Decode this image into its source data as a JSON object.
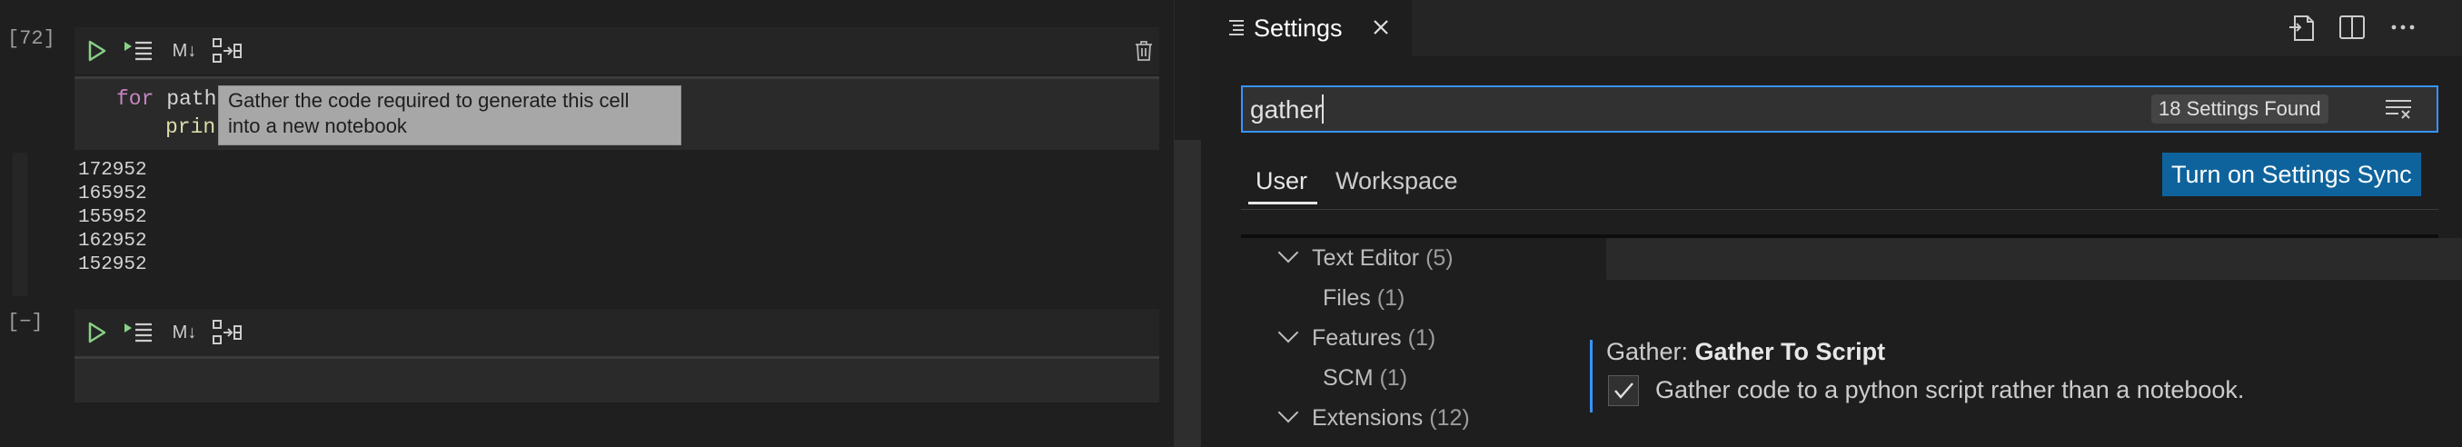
{
  "notebook": {
    "cell1": {
      "exec_count": "[72]",
      "toolbar": {
        "run_label": "run-cell",
        "markdown_label": "M↓",
        "gather_label": "gather-cell"
      },
      "code": {
        "line1_kw": "for",
        "line1_rest": " path",
        "line2_fn": "prin"
      },
      "tooltip": {
        "line1": "Gather the code required to generate this cell",
        "line2": "into a new notebook"
      },
      "outputs": [
        "172952",
        "165952",
        "155952",
        "162952",
        "152952"
      ]
    },
    "cell2": {
      "exec_count": "[−]",
      "toolbar": {
        "markdown_label": "M↓"
      }
    }
  },
  "settings": {
    "tab": {
      "title": "Settings"
    },
    "search": {
      "value": "gather",
      "results_badge": "18 Settings Found"
    },
    "sync_button": "Turn on Settings Sync",
    "scopes": [
      "User",
      "Workspace"
    ],
    "toc": [
      {
        "label": "Text Editor",
        "count": "(5)"
      },
      {
        "label": "Files",
        "count": "(1)"
      },
      {
        "label": "Features",
        "count": "(1)"
      },
      {
        "label": "SCM",
        "count": "(1)"
      },
      {
        "label": "Extensions",
        "count": "(12)"
      }
    ],
    "setting": {
      "category": "Gather: ",
      "name": "Gather To Script",
      "description": "Gather code to a python script rather than a notebook.",
      "checked": true
    }
  },
  "colors": {
    "accent": "#3794ff",
    "button": "#0e639c",
    "run_icon": "#89d185",
    "keyword": "#c586c0"
  }
}
